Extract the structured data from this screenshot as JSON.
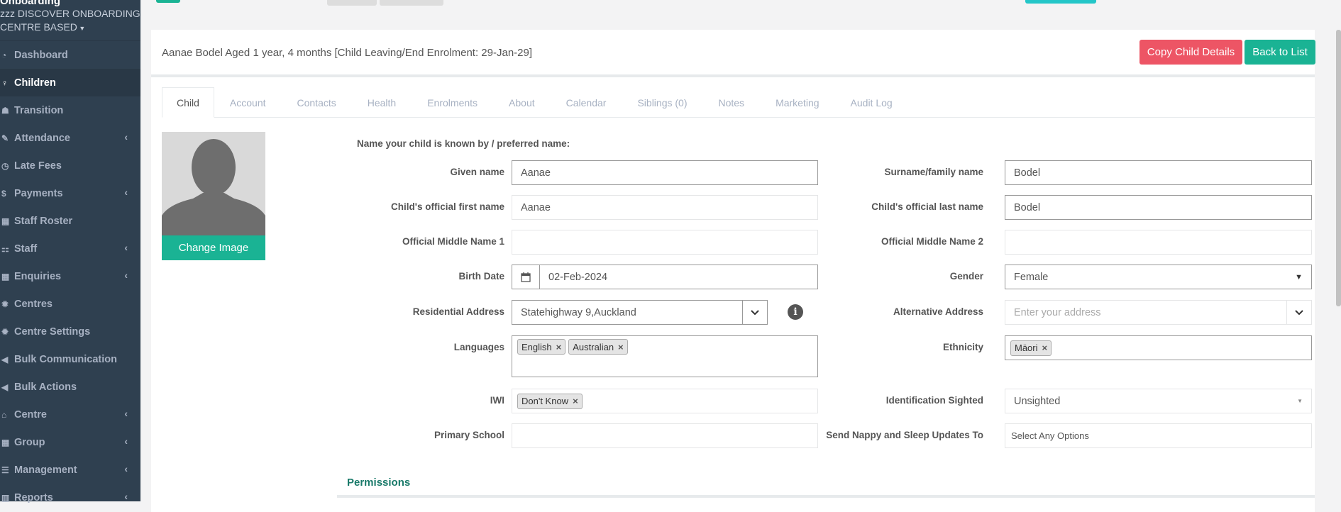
{
  "sidebar": {
    "org_title": "Onboarding",
    "org_sub1": "zzz DISCOVER ONBOARDING",
    "org_sub2": "CENTRE BASED",
    "items": [
      {
        "label": "Dashboard",
        "icon": "pie-chart-icon",
        "chevron": false
      },
      {
        "label": "Children",
        "icon": "child-icon",
        "chevron": false
      },
      {
        "label": "Transition",
        "icon": "graduation-cap-icon",
        "chevron": false
      },
      {
        "label": "Attendance",
        "icon": "edit-icon",
        "chevron": true
      },
      {
        "label": "Late Fees",
        "icon": "clock-icon",
        "chevron": false
      },
      {
        "label": "Payments",
        "icon": "dollar-icon",
        "chevron": true
      },
      {
        "label": "Staff Roster",
        "icon": "calendar-icon",
        "chevron": false
      },
      {
        "label": "Staff",
        "icon": "sitemap-icon",
        "chevron": true
      },
      {
        "label": "Enquiries",
        "icon": "grid-icon",
        "chevron": true
      },
      {
        "label": "Centres",
        "icon": "gear-icon",
        "chevron": false
      },
      {
        "label": "Centre Settings",
        "icon": "gear-icon",
        "chevron": false
      },
      {
        "label": "Bulk Communication",
        "icon": "bullhorn-icon",
        "chevron": false
      },
      {
        "label": "Bulk Actions",
        "icon": "bullhorn-icon",
        "chevron": false
      },
      {
        "label": "Centre",
        "icon": "bank-icon",
        "chevron": true
      },
      {
        "label": "Group",
        "icon": "grid-icon",
        "chevron": true
      },
      {
        "label": "Management",
        "icon": "list-icon",
        "chevron": true
      },
      {
        "label": "Reports",
        "icon": "chart-icon",
        "chevron": true
      }
    ]
  },
  "header": {
    "title": "Aanae Bodel Aged 1 year, 4 months [Child Leaving/End Enrolment: 29-Jan-29]",
    "copy_btn": "Copy Child Details",
    "back_btn": "Back to List"
  },
  "tabs": [
    "Child",
    "Account",
    "Contacts",
    "Health",
    "Enrolments",
    "About",
    "Calendar",
    "Siblings (0)",
    "Notes",
    "Marketing",
    "Audit Log"
  ],
  "photo": {
    "change_label": "Change Image"
  },
  "form": {
    "preferred_heading": "Name your child is known by / preferred name:",
    "given_name_label": "Given name",
    "given_name": "Aanae",
    "surname_label": "Surname/family name",
    "surname": "Bodel",
    "official_first_label": "Child's official first name",
    "official_first": "Aanae",
    "official_last_label": "Child's official last name",
    "official_last": "Bodel",
    "middle1_label": "Official Middle Name 1",
    "middle1": "",
    "middle2_label": "Official Middle Name 2",
    "middle2": "",
    "birth_label": "Birth Date",
    "birth": "02-Feb-2024",
    "gender_label": "Gender",
    "gender": "Female",
    "res_addr_label": "Residential Address",
    "res_addr": "Statehighway 9,Auckland",
    "alt_addr_label": "Alternative Address",
    "alt_addr_placeholder": "Enter your address",
    "languages_label": "Languages",
    "languages": [
      "English",
      "Australian"
    ],
    "ethnicity_label": "Ethnicity",
    "ethnicity": [
      "Māori"
    ],
    "iwi_label": "IWI",
    "iwi": [
      "Don't Know"
    ],
    "id_sighted_label": "Identification Sighted",
    "id_sighted": "Unsighted",
    "primary_school_label": "Primary School",
    "primary_school": "",
    "nappy_label": "Send Nappy and Sleep Updates To",
    "nappy_placeholder": "Select Any Options",
    "permissions_heading": "Permissions"
  }
}
